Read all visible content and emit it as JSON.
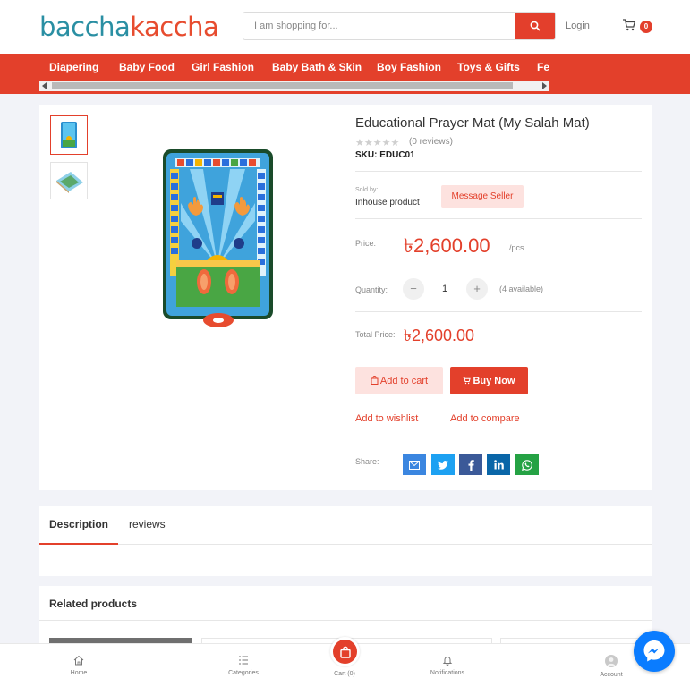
{
  "header": {
    "logo_part1": "baccha",
    "logo_part2": "kaccha",
    "search_placeholder": "I am shopping for...",
    "login_label": "Login",
    "cart_count": "0"
  },
  "categories": [
    "Diapering",
    "Baby Food",
    "Girl Fashion",
    "Baby Bath & Skin",
    "Boy Fashion",
    "Toys & Gifts",
    "Fe"
  ],
  "product": {
    "title": "Educational Prayer Mat (My Salah Mat)",
    "stars": "★★★★★",
    "reviews_count": "(0 reviews)",
    "sku": "SKU: EDUC01",
    "sold_by_label": "Sold by:",
    "sold_by_value": "Inhouse product",
    "message_seller": "Message Seller",
    "price_label": "Price:",
    "price": "৳2,600.00",
    "price_unit": "/pcs",
    "quantity_label": "Quantity:",
    "quantity_minus": "−",
    "quantity_value": "1",
    "quantity_plus": "+",
    "available": "(4 available)",
    "total_label": "Total Price:",
    "total_price": "৳2,600.00",
    "add_to_cart": "Add to cart",
    "buy_now": "Buy Now",
    "add_to_wishlist": "Add to wishlist",
    "add_to_compare": "Add to compare",
    "share_label": "Share:"
  },
  "share_buttons": [
    {
      "name": "email-share-button",
      "icon": "email-icon",
      "color": "#3b86e0"
    },
    {
      "name": "twitter-share-button",
      "icon": "twitter-icon",
      "color": "#1da1f2"
    },
    {
      "name": "facebook-share-button",
      "icon": "facebook-icon",
      "color": "#3b5998"
    },
    {
      "name": "linkedin-share-button",
      "icon": "linkedin-icon",
      "color": "#0a66a8"
    },
    {
      "name": "whatsapp-share-button",
      "icon": "whatsapp-icon",
      "color": "#25a244"
    }
  ],
  "tabs": {
    "description": "Description",
    "reviews": "reviews"
  },
  "related": {
    "title": "Related products"
  },
  "bottom_nav": {
    "home": "Home",
    "categories": "Categories",
    "cart": "Cart (0)",
    "notifications": "Notifications",
    "account": "Account"
  },
  "colors": {
    "accent": "#e3402b",
    "logo_teal": "#2a8fa3",
    "messenger": "#0a7cff"
  }
}
